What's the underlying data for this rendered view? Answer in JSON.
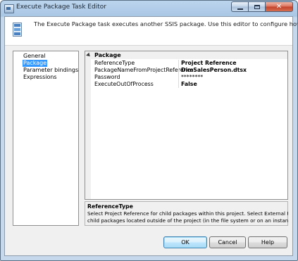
{
  "window": {
    "title": "Execute Package Task Editor"
  },
  "header": {
    "description": "The Execute Package task executes another SSIS package. Use this editor to configure how the child package runs."
  },
  "nav": {
    "items": [
      {
        "label": "General",
        "selected": false
      },
      {
        "label": "Package",
        "selected": true
      },
      {
        "label": "Parameter bindings",
        "selected": false
      },
      {
        "label": "Expressions",
        "selected": false
      }
    ]
  },
  "property_grid": {
    "category": "Package",
    "rows": [
      {
        "name": "ReferenceType",
        "value": "Project Reference",
        "bold": true
      },
      {
        "name": "PackageNameFromProjectReference",
        "value": "DimSalesPerson.dtsx",
        "bold": true
      },
      {
        "name": "Password",
        "value": "********",
        "bold": false
      },
      {
        "name": "ExecuteOutOfProcess",
        "value": "False",
        "bold": true
      }
    ]
  },
  "description_panel": {
    "title": "ReferenceType",
    "body": "Select Project Reference for child packages within this project. Select External Reference for\nchild packages located outside of the project (in the file system or on an instance of SQL Serv..."
  },
  "buttons": {
    "ok": "OK",
    "cancel": "Cancel",
    "help": "Help"
  },
  "colors": {
    "selection": "#3399ff",
    "window_frame": "#c6d9ec",
    "close_button": "#c2412a"
  }
}
